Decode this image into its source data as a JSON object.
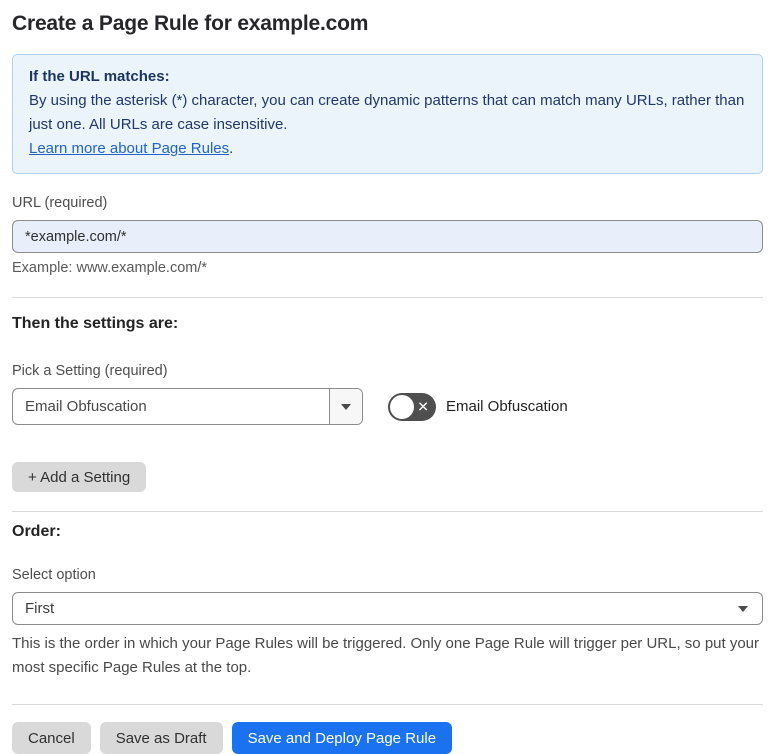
{
  "page": {
    "title": "Create a Page Rule for example.com"
  },
  "info_box": {
    "heading": "If the URL matches:",
    "body": "By using the asterisk (*) character, you can create dynamic patterns that can match many URLs, rather than just one. All URLs are case insensitive.",
    "link_label": "Learn more about Page Rules",
    "link_suffix": "."
  },
  "url_field": {
    "label": "URL (required)",
    "value": "*example.com/*",
    "example": "Example: www.example.com/*"
  },
  "settings_section": {
    "heading": "Then the settings are:",
    "picker_label": "Pick a Setting (required)",
    "picker_value": "Email Obfuscation",
    "picker_arrow_icon": "triangle-down",
    "toggle_state": "off",
    "toggle_glyph": "✕",
    "toggle_label": "Email Obfuscation",
    "add_setting_label": "+ Add a Setting"
  },
  "order_section": {
    "heading": "Order:",
    "select_label": "Select option",
    "select_value": "First",
    "select_arrow_icon": "triangle-down",
    "help_text": "This is the order in which your Page Rules will be triggered. Only one Page Rule will trigger per URL, so put your most specific Page Rules at the top."
  },
  "footer": {
    "cancel_label": "Cancel",
    "save_draft_label": "Save as Draft",
    "save_deploy_label": "Save and Deploy Page Rule"
  },
  "colors": {
    "primary_button_blue": "#1b72f0",
    "info_box_background": "#ebf3fb",
    "info_box_border": "#afd2f1",
    "info_box_text": "#20386b",
    "link_blue": "#2264cc",
    "url_input_background": "#e8effb",
    "toggle_off_background": "#4f4f4f",
    "secondary_button_gray": "#d9d9d9"
  }
}
